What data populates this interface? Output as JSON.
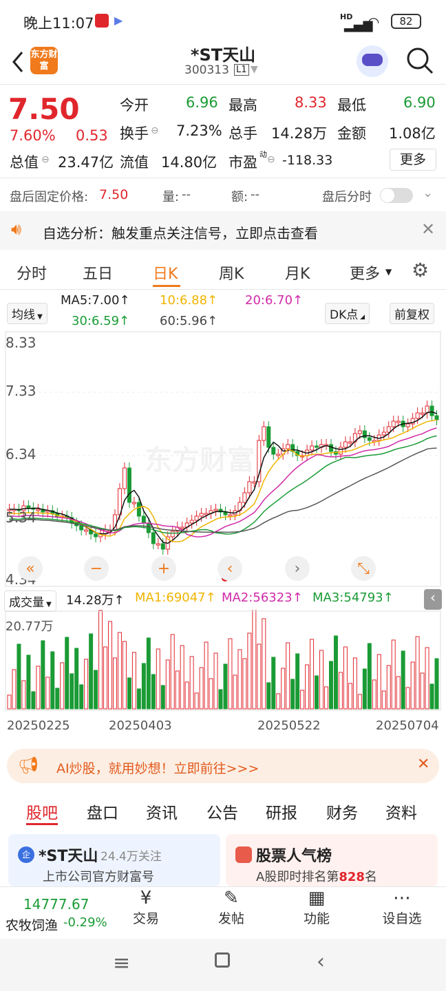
{
  "status": {
    "time": "晚上11:07",
    "battery": "82",
    "net": "HD"
  },
  "header": {
    "name": "*ST天山",
    "code": "300313",
    "level": "L1",
    "logo": "东方财富"
  },
  "quote": {
    "price": "7.50",
    "pct": "7.60%",
    "chg": "0.53",
    "open_l": "今开",
    "open": "6.96",
    "high_l": "最高",
    "high": "8.33",
    "low_l": "最低",
    "low": "6.90",
    "turn_l": "换手",
    "turn": "7.23%",
    "vol_l": "总手",
    "vol": "14.28万",
    "amt_l": "金额",
    "amt": "1.08亿",
    "mcap_l": "总值",
    "mcap": "23.47亿",
    "float_l": "流值",
    "float": "14.80亿",
    "pe_l": "市盈",
    "pe_sup": "动",
    "pe": "-118.33",
    "more": "更多"
  },
  "after": {
    "fixed_l": "盘后固定价格:",
    "fixed": "7.50",
    "vol_l": "量:",
    "vol": "--",
    "amt_l": "额:",
    "amt": "--",
    "tline": "盘后分时"
  },
  "notice": "自选分析：触发重点关注信号，立即点击查看",
  "tabs": [
    "分时",
    "五日",
    "日K",
    "周K",
    "月K",
    "更多"
  ],
  "ma": {
    "type": "均线",
    "ma5": "MA5:7.00↑",
    "ma10": "10:6.88↑",
    "ma20": "20:6.70↑",
    "ma30": "30:6.59↑",
    "ma60": "60:5.96↑",
    "dk": "DK点",
    "adj": "前复权"
  },
  "axis": {
    "p1": "8.33",
    "p2": "7.33",
    "p3": "6.34",
    "p4": "5.34",
    "p5": "4.34",
    "vtop": "20.77万"
  },
  "vol": {
    "label": "成交量",
    "v": "14.28万↑",
    "ma1": "MA1:69047↑",
    "ma2": "MA2:56323↑",
    "ma3": "MA3:54793↑"
  },
  "dates": [
    "20250225",
    "20250403",
    "20250522",
    "20250704"
  ],
  "watermark": "东方财富",
  "ad": {
    "text": "AI炒股，就用妙想！立即前往>>>"
  },
  "subtabs": [
    "股吧",
    "盘口",
    "资讯",
    "公告",
    "研报",
    "财务",
    "资料"
  ],
  "cards": {
    "c1_title": "*ST天山",
    "c1_follow": "24.4万关注",
    "c1_sub": "上市公司官方财富号",
    "c2_title": "股票人气榜",
    "c2_sub_a": "A股即时排名第",
    "c2_rank": "828",
    "c2_sub_b": "名"
  },
  "bottom": {
    "index": "14777.67",
    "index_name": "农牧饲渔",
    "index_chg": "-0.29%",
    "items": [
      "交易",
      "发帖",
      "功能",
      "设自选"
    ]
  },
  "colors": {
    "up": "#e0262d",
    "down": "#1a9b35",
    "accent": "#f07a1c"
  }
}
